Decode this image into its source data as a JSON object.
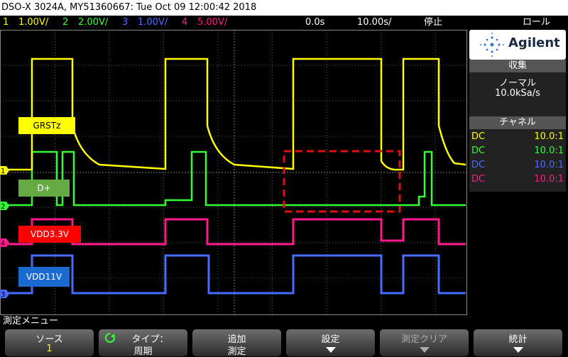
{
  "title": "DSO-X 3024A, MY51360667: Tue Oct 09 12:00:42 2018",
  "status": {
    "ch1": {
      "num": "1",
      "scale": "1.00V/",
      "color": "#ffff00"
    },
    "ch2": {
      "num": "2",
      "scale": "2.00V/",
      "color": "#33ff33"
    },
    "ch3": {
      "num": "3",
      "scale": "1.00V/",
      "color": "#4a6bff"
    },
    "ch4": {
      "num": "4",
      "scale": "5.00V/",
      "color": "#ff1a8c"
    },
    "delay": "0.0s",
    "timebase": "10.00s/",
    "run_state": "停止",
    "mode": "ロール"
  },
  "brand": "Agilent",
  "acquisition": {
    "header": "収集",
    "mode": "ノーマル",
    "rate": "10.0kSa/s"
  },
  "channels": {
    "header": "チャネル",
    "rows": [
      {
        "coupling": "DC",
        "probe": "10.0:1",
        "color": "#ffff00"
      },
      {
        "coupling": "DC",
        "probe": "10.0:1",
        "color": "#33ff33"
      },
      {
        "coupling": "DC",
        "probe": "10.0:1",
        "color": "#4a6bff"
      },
      {
        "coupling": "DC",
        "probe": "10.0:1",
        "color": "#ff1a8c"
      }
    ]
  },
  "trace_labels": {
    "grstz": "GRSTz",
    "dplus": "D+",
    "vdd33": "VDD3.3V",
    "vdd11": "VDD11V"
  },
  "channel_markers": {
    "m1": "1",
    "m2": "2",
    "m3": "3",
    "m4": "4"
  },
  "menu_title": "測定メニュー",
  "softkeys": [
    {
      "label1": "ソース",
      "label2": "1"
    },
    {
      "label1": "タイプ：",
      "label2": "周期"
    },
    {
      "label1": "追加",
      "label2": "測定"
    },
    {
      "label1": "設定",
      "label2": ""
    },
    {
      "label1": "測定クリア",
      "label2": ""
    },
    {
      "label1": "統計",
      "label2": ""
    }
  ]
}
